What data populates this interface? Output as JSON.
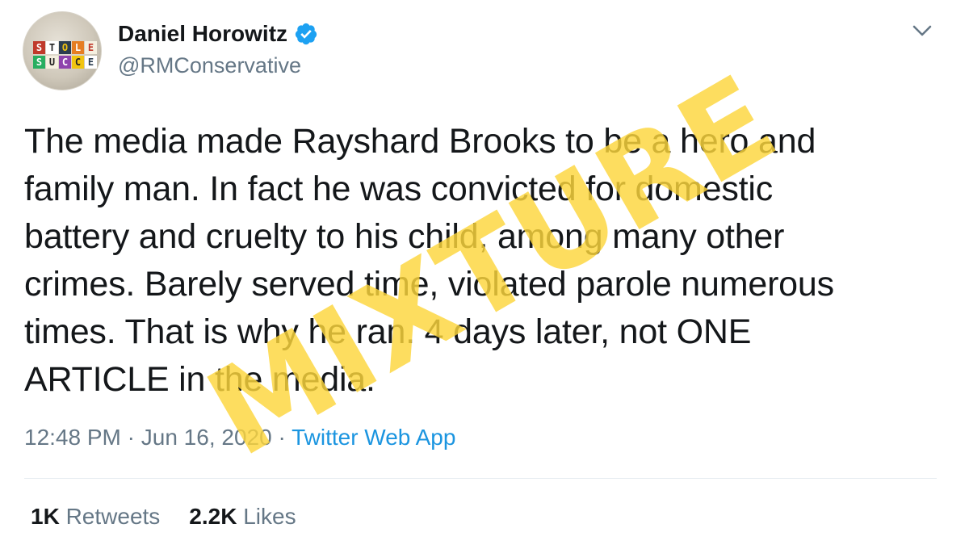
{
  "author": {
    "display_name": "Daniel Horowitz",
    "handle": "@RMConservative",
    "verified": true
  },
  "tweet": {
    "lines": [
      "The media made Rayshard Brooks to be a hero and",
      "family man. In fact he was convicted for domestic",
      "battery and cruelty to his child, among many other",
      "crimes. Barely served time, violated parole numerous",
      "times. That is why he ran. 4 days later, not ONE",
      "ARTICLE in the media."
    ],
    "time": "12:48 PM",
    "date": "Jun 16, 2020",
    "separator": "·",
    "source": "Twitter Web App"
  },
  "stats": {
    "retweets_count": "1K",
    "retweets_label": "Retweets",
    "likes_count": "2.2K",
    "likes_label": "Likes"
  },
  "overlay": {
    "stamp_text": "MIXTURE",
    "stamp_color": "#fcd63c"
  },
  "colors": {
    "text": "#14171a",
    "secondary": "#657786",
    "link": "#1b95e0",
    "verified": "#1da1f2"
  },
  "icons": {
    "verified": "verified-badge-icon",
    "caret": "chevron-down-icon"
  }
}
